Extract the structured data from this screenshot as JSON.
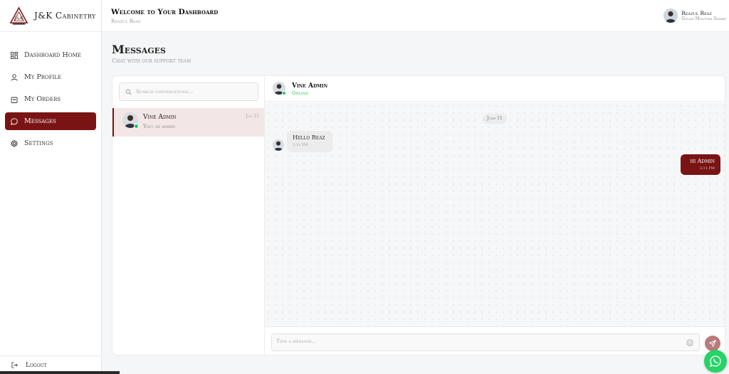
{
  "app": {
    "brand": "J&K Cabinetry",
    "accent_color": "#7a1414"
  },
  "sidebar": {
    "items": [
      {
        "label": "Dashboard Home",
        "icon": "grid-icon",
        "active": false
      },
      {
        "label": "My Profile",
        "icon": "user-icon",
        "active": false
      },
      {
        "label": "My Orders",
        "icon": "bag-icon",
        "active": false
      },
      {
        "label": "Messages",
        "icon": "chat-bubble-icon",
        "active": true
      },
      {
        "label": "Settings",
        "icon": "gear-icon",
        "active": false
      }
    ],
    "logout": "Logout"
  },
  "header": {
    "welcome": "Welcome to Your Dashboard",
    "subtitle": "Reazul Reaz",
    "user_name": "Reazul Reaz",
    "user_sub": "Golam Mostofa Sharif"
  },
  "page": {
    "title": "Messages",
    "subtitle": "Chat with our support team"
  },
  "conversations": {
    "search_placeholder": "Search conversations...",
    "items": [
      {
        "name": "Vine Admin",
        "last": "You: hi admin",
        "date": "Jun 11",
        "online": true
      }
    ]
  },
  "chat": {
    "name": "Vine Admin",
    "status": "Online",
    "status_color": "#22c55e",
    "date_chip": "June 11",
    "messages": [
      {
        "direction": "in",
        "text": "Hello Reaz",
        "time": "2:11 PM"
      },
      {
        "direction": "out",
        "text": "hi Admin",
        "time": "2:11 PM"
      }
    ],
    "input_placeholder": "Type a message..."
  }
}
